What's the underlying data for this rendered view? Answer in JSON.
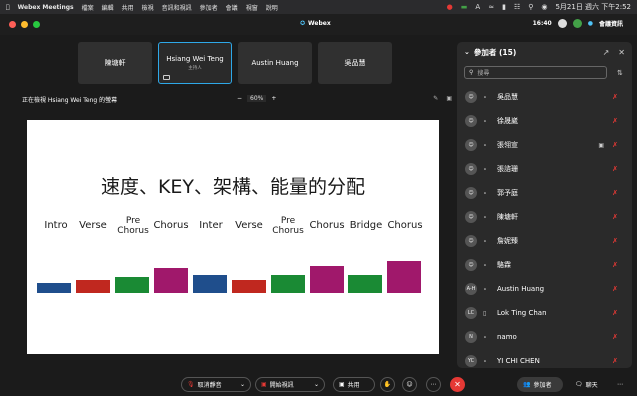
{
  "menubar": {
    "app_name": "Webex Meetings",
    "items": [
      "檔案",
      "編輯",
      "共用",
      "檢視",
      "音訊和視訊",
      "參加者",
      "會議",
      "視窗",
      "說明"
    ],
    "datetime": "5月21日 週六 下午2:52"
  },
  "titlebar": {
    "title": "Webex",
    "time": "16:40",
    "info_label": "會議資訊"
  },
  "video_tiles": [
    {
      "name": "陳塘軒",
      "sub": ""
    },
    {
      "name": "Hsiang Wei Teng",
      "sub": "主持人"
    },
    {
      "name": "Austin Huang",
      "sub": ""
    },
    {
      "name": "吳品慧",
      "sub": ""
    }
  ],
  "share": {
    "viewing_text": "正在檢視 Hsiang Wei Teng 的螢幕",
    "zoom": "60%",
    "zoom_minus": "−",
    "zoom_plus": "+"
  },
  "slide": {
    "title": "速度、KEY、架構、能量的分配"
  },
  "chart_data": {
    "type": "bar",
    "categories": [
      "Intro",
      "Verse",
      "Pre Chorus",
      "Chorus",
      "Inter",
      "Verse",
      "Pre Chorus",
      "Chorus",
      "Bridge",
      "Chorus"
    ],
    "values": [
      1.0,
      1.3,
      1.6,
      2.5,
      1.8,
      1.3,
      1.8,
      2.7,
      1.8,
      3.2
    ],
    "colors": [
      "#1f4e8c",
      "#c0281f",
      "#1a8a34",
      "#a0186b",
      "#1f4e8c",
      "#c0281f",
      "#1a8a34",
      "#a0186b",
      "#1a8a34",
      "#a0186b"
    ],
    "title": "速度、KEY、架構、能量的分配"
  },
  "participants_panel": {
    "title": "參加者 (15)",
    "search_placeholder": "搜尋",
    "people": [
      {
        "initials": "",
        "name": "吳品慧",
        "device": "headset",
        "camera": false
      },
      {
        "initials": "",
        "name": "徐晟崴",
        "device": "headset",
        "camera": false
      },
      {
        "initials": "",
        "name": "張翎宣",
        "device": "headset",
        "camera": true
      },
      {
        "initials": "",
        "name": "張諮珊",
        "device": "headset",
        "camera": false
      },
      {
        "initials": "",
        "name": "郭予庭",
        "device": "headset",
        "camera": false
      },
      {
        "initials": "",
        "name": "陳塘軒",
        "device": "headset",
        "camera": false
      },
      {
        "initials": "",
        "name": "詹妮臻",
        "device": "headset",
        "camera": false
      },
      {
        "initials": "",
        "name": "駱霖",
        "device": "headset",
        "camera": false
      },
      {
        "initials": "A-H",
        "name": "Austin Huang",
        "device": "headset",
        "camera": false
      },
      {
        "initials": "LC",
        "name": "Lok Ting Chan",
        "device": "mobile",
        "camera": false
      },
      {
        "initials": "N",
        "name": "namo",
        "device": "headset",
        "camera": false
      },
      {
        "initials": "YC",
        "name": "YI CHI CHEN",
        "device": "headset",
        "camera": false
      }
    ]
  },
  "bottombar": {
    "unmute_label": "取消靜音",
    "video_label": "開始視訊",
    "share_label": "共用",
    "participants_label": "參加者",
    "chat_label": "聊天"
  }
}
